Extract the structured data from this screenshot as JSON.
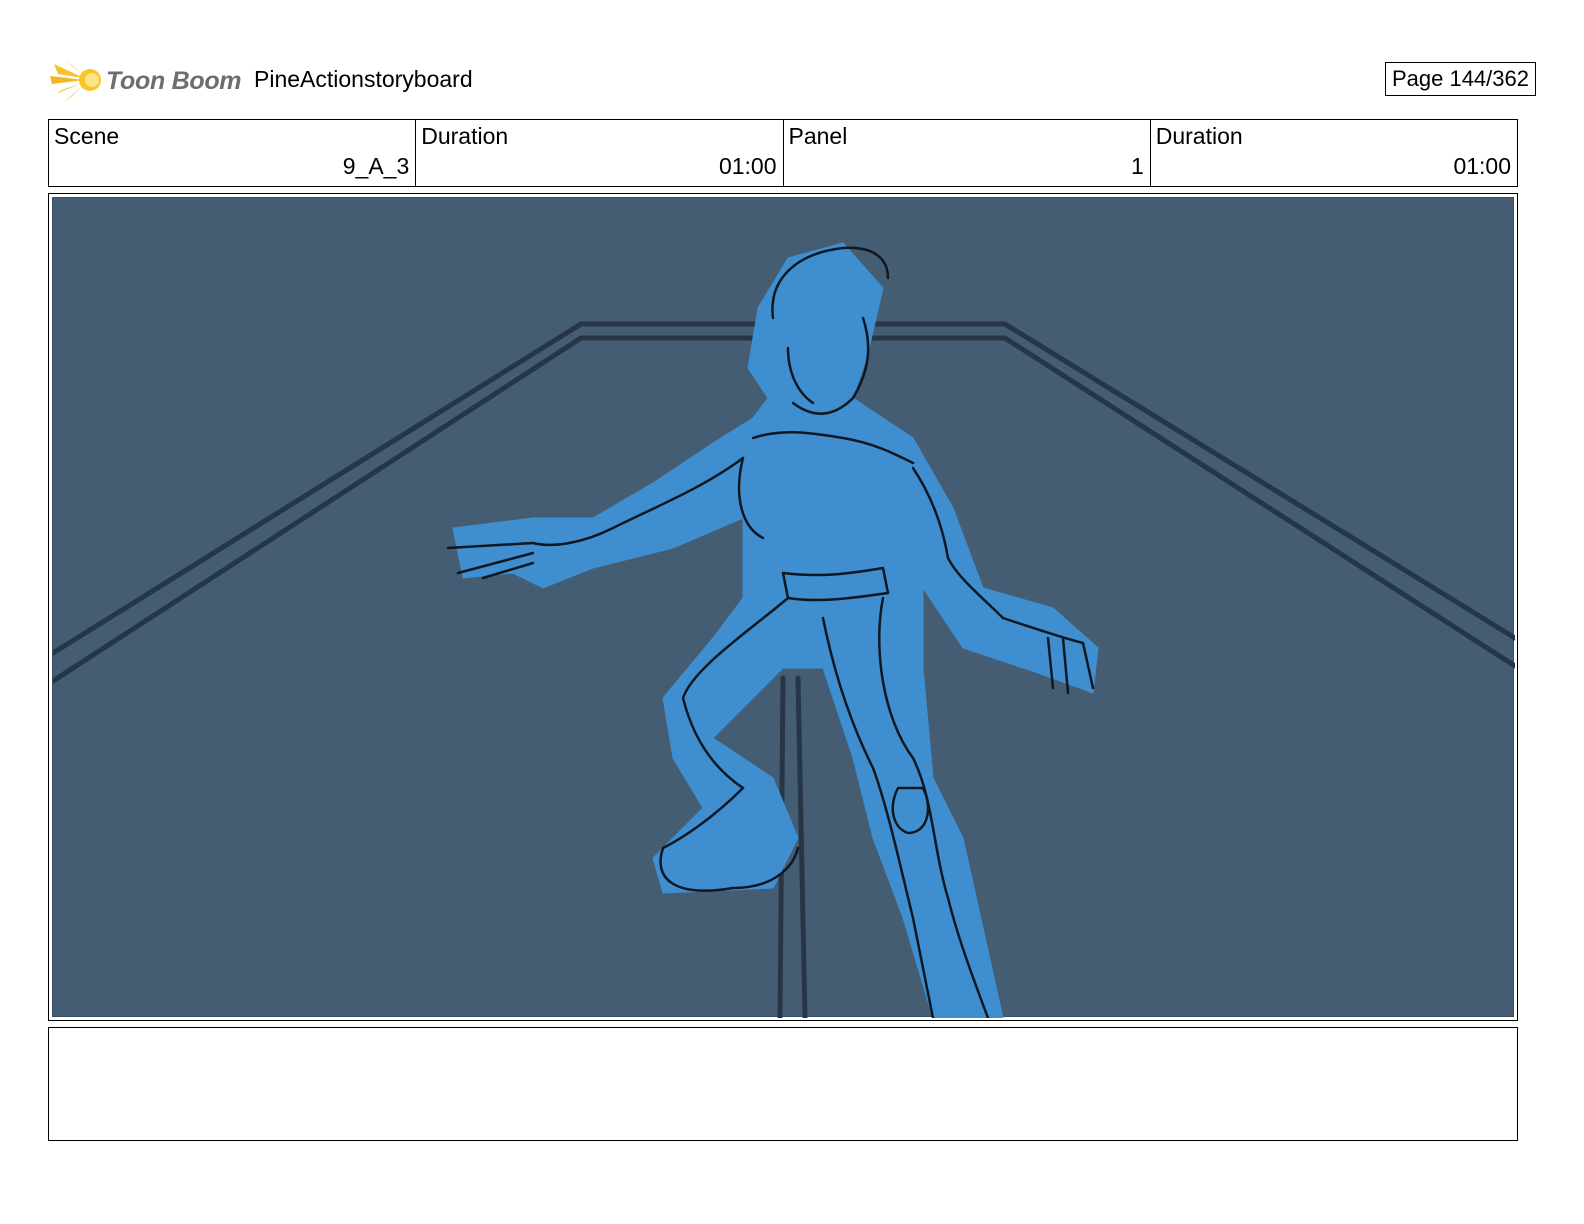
{
  "header": {
    "logo_text": "Toon Boom",
    "project_title": "PineActionstoryboard",
    "page_label": "Page 144/362"
  },
  "info": [
    {
      "label": "Scene",
      "value": "9_A_3"
    },
    {
      "label": "Duration",
      "value": "01:00"
    },
    {
      "label": "Panel",
      "value": "1"
    },
    {
      "label": "Duration",
      "value": "01:00"
    }
  ],
  "panel": {
    "background_color": "#445d73",
    "figure_color": "#3f8fd0"
  },
  "notes": {
    "text": ""
  }
}
